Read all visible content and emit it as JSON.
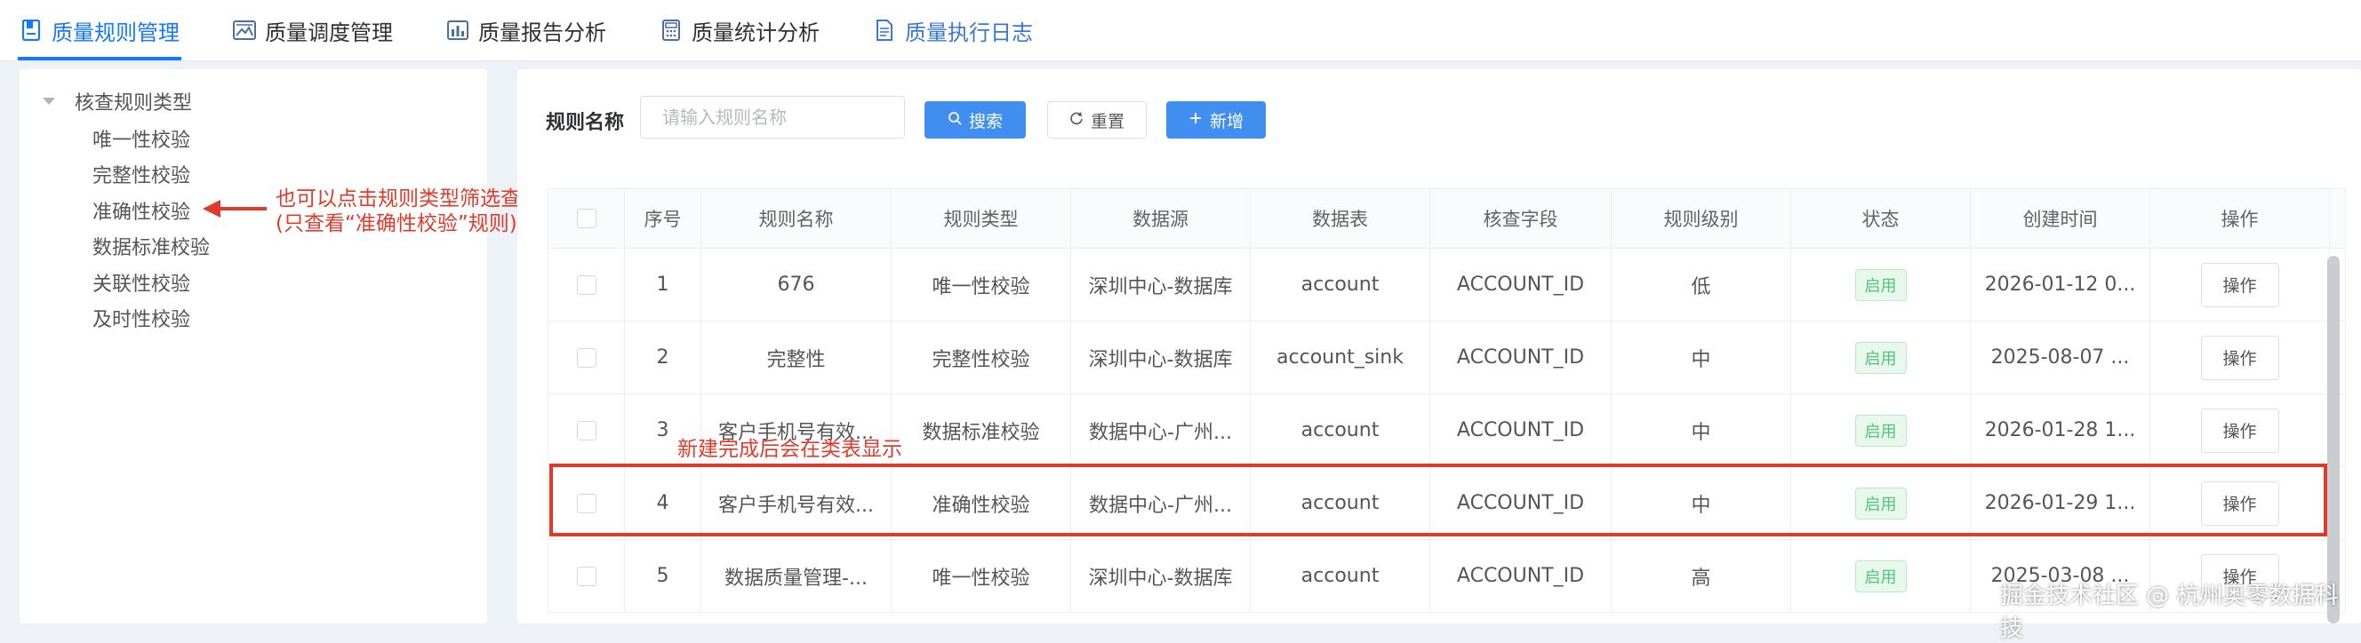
{
  "tabs": [
    {
      "label": "质量规则管理",
      "icon": "rule-doc-icon"
    },
    {
      "label": "质量调度管理",
      "icon": "schedule-image-icon"
    },
    {
      "label": "质量报告分析",
      "icon": "bar-chart-icon"
    },
    {
      "label": "质量统计分析",
      "icon": "calculator-icon"
    },
    {
      "label": "质量执行日志",
      "icon": "log-doc-icon"
    }
  ],
  "tree": {
    "root": "核查规则类型",
    "items": [
      "唯一性校验",
      "完整性校验",
      "准确性校验",
      "数据标准校验",
      "关联性校验",
      "及时性校验"
    ]
  },
  "annotations": {
    "filter_note_line1": "也可以点击规则类型筛选查看",
    "filter_note_line2": "(只查看“准确性校验”规则)",
    "new_note": "新建完成后会在类表显示"
  },
  "search": {
    "label": "规则名称",
    "placeholder": "请输入规则名称",
    "search_btn": "搜索",
    "reset_btn": "重置",
    "add_btn": "新增"
  },
  "table": {
    "headers": [
      "序号",
      "规则名称",
      "规则类型",
      "数据源",
      "数据表",
      "核查字段",
      "规则级别",
      "状态",
      "创建时间",
      "操作"
    ],
    "rows": [
      {
        "no": "1",
        "name": "676",
        "type": "唯一性校验",
        "source": "深圳中心-数据库",
        "table": "account",
        "field": "ACCOUNT_ID",
        "level": "低",
        "status": "启用",
        "time": "2026-01-12 0...",
        "op": "操作"
      },
      {
        "no": "2",
        "name": "完整性",
        "type": "完整性校验",
        "source": "深圳中心-数据库",
        "table": "account_sink",
        "field": "ACCOUNT_ID",
        "level": "中",
        "status": "启用",
        "time": "2025-08-07 ...",
        "op": "操作"
      },
      {
        "no": "3",
        "name": "客户手机号有效...",
        "type": "数据标准校验",
        "source": "数据中心-广州...",
        "table": "account",
        "field": "ACCOUNT_ID",
        "level": "中",
        "status": "启用",
        "time": "2026-01-28 1...",
        "op": "操作"
      },
      {
        "no": "4",
        "name": "客户手机号有效...",
        "type": "准确性校验",
        "source": "数据中心-广州...",
        "table": "account",
        "field": "ACCOUNT_ID",
        "level": "中",
        "status": "启用",
        "time": "2026-01-29 1...",
        "op": "操作"
      },
      {
        "no": "5",
        "name": "数据质量管理-...",
        "type": "唯一性校验",
        "source": "深圳中心-数据库",
        "table": "account",
        "field": "ACCOUNT_ID",
        "level": "高",
        "status": "启用",
        "time": "2025-03-08 ...",
        "op": "操作"
      }
    ]
  },
  "watermark": "掘金技术社区 @ 杭州奥零数据科技",
  "colors": {
    "accent": "#1677ff",
    "annotation": "#e03b2a",
    "status_green": "#52c47a"
  }
}
